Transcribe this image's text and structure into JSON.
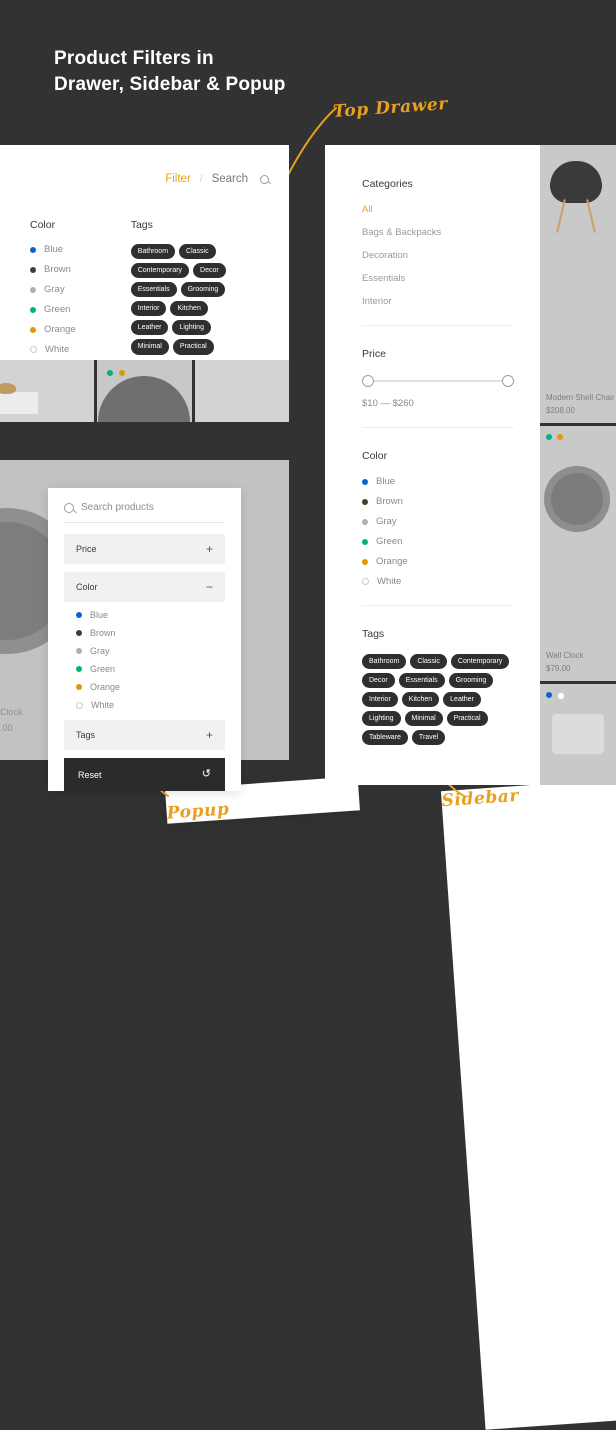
{
  "headline": {
    "line1": "Product Filters in",
    "line2": "Drawer, Sidebar & Popup"
  },
  "annotations": {
    "top_drawer": "Top Drawer",
    "popup": "Popup",
    "sidebar": "Sidebar"
  },
  "colors": {
    "accent": "#e8a020",
    "page_bg": "#333232",
    "panel_bg": "#ffffff",
    "tag_bg": "#2f2f2f",
    "blue": "#0b63ce",
    "brown": "#4a3c28",
    "gray": "#b0b0b0",
    "green": "#00b189",
    "orange": "#e09a00",
    "white": "#ffffff"
  },
  "drawer": {
    "tabs": {
      "filter_label": "Filter",
      "separator": "/",
      "search_label": "Search",
      "search_icon": "search-icon"
    },
    "color_section": {
      "title": "Color",
      "options": [
        {
          "label": "Blue",
          "swatch": "#0b63ce",
          "hollow": false
        },
        {
          "label": "Brown",
          "swatch": "#4a3c28",
          "hollow": false
        },
        {
          "label": "Gray",
          "swatch": "#b0b0b0",
          "hollow": false
        },
        {
          "label": "Green",
          "swatch": "#00b189",
          "hollow": false
        },
        {
          "label": "Orange",
          "swatch": "#e09a00",
          "hollow": false
        },
        {
          "label": "White",
          "swatch": "#ffffff",
          "hollow": true
        }
      ]
    },
    "tags_section": {
      "title": "Tags",
      "tags": [
        "Bathroom",
        "Classic",
        "Contemporary",
        "Decor",
        "Essentials",
        "Grooming",
        "Interior",
        "Kitchen",
        "Leather",
        "Lighting",
        "Minimal",
        "Practical"
      ]
    }
  },
  "popup": {
    "search": {
      "placeholder": "Search products",
      "icon": "search-icon"
    },
    "accordion": [
      {
        "label": "Price",
        "sign": "+",
        "expanded": false
      },
      {
        "label": "Color",
        "sign": "−",
        "expanded": true
      },
      {
        "label": "Tags",
        "sign": "+",
        "expanded": false
      }
    ],
    "color_options": [
      {
        "label": "Blue",
        "swatch": "#0b63ce",
        "hollow": false
      },
      {
        "label": "Brown",
        "swatch": "#4a3c28",
        "hollow": false
      },
      {
        "label": "Gray",
        "swatch": "#b0b0b0",
        "hollow": false
      },
      {
        "label": "Green",
        "swatch": "#00b189",
        "hollow": false
      },
      {
        "label": "Orange",
        "swatch": "#e09a00",
        "hollow": false
      },
      {
        "label": "White",
        "swatch": "#ffffff",
        "hollow": true
      }
    ],
    "reset": {
      "label": "Reset",
      "icon": "refresh-icon",
      "glyph": "↺"
    },
    "background_product": {
      "name": "Clock",
      "price": ".00"
    }
  },
  "sidebar": {
    "categories": {
      "title": "Categories",
      "items": [
        {
          "label": "All",
          "active": true
        },
        {
          "label": "Bags & Backpacks",
          "active": false
        },
        {
          "label": "Decoration",
          "active": false
        },
        {
          "label": "Essentials",
          "active": false
        },
        {
          "label": "Interior",
          "active": false
        }
      ]
    },
    "price": {
      "title": "Price",
      "range_label": "$10 — $260",
      "min": 10,
      "max": 260
    },
    "color": {
      "title": "Color",
      "options": [
        {
          "label": "Blue",
          "swatch": "#0b63ce",
          "hollow": false
        },
        {
          "label": "Brown",
          "swatch": "#4a3c28",
          "hollow": false
        },
        {
          "label": "Gray",
          "swatch": "#b0b0b0",
          "hollow": false
        },
        {
          "label": "Green",
          "swatch": "#00b189",
          "hollow": false
        },
        {
          "label": "Orange",
          "swatch": "#e09a00",
          "hollow": false
        },
        {
          "label": "White",
          "swatch": "#ffffff",
          "hollow": true
        }
      ]
    },
    "tags": {
      "title": "Tags",
      "items": [
        "Bathroom",
        "Classic",
        "Contemporary",
        "Decor",
        "Essentials",
        "Grooming",
        "Interior",
        "Kitchen",
        "Leather",
        "Lighting",
        "Minimal",
        "Practical",
        "Tableware",
        "Travel"
      ]
    }
  },
  "products": [
    {
      "name": "Modern Shell Chair",
      "price": "$208.00",
      "swatches": []
    },
    {
      "name": "Wall Clock",
      "price": "$79.00",
      "swatches": [
        "#00b189",
        "#e09a00"
      ]
    }
  ],
  "product_dots": [
    "#0b63ce",
    "#ffffff"
  ]
}
